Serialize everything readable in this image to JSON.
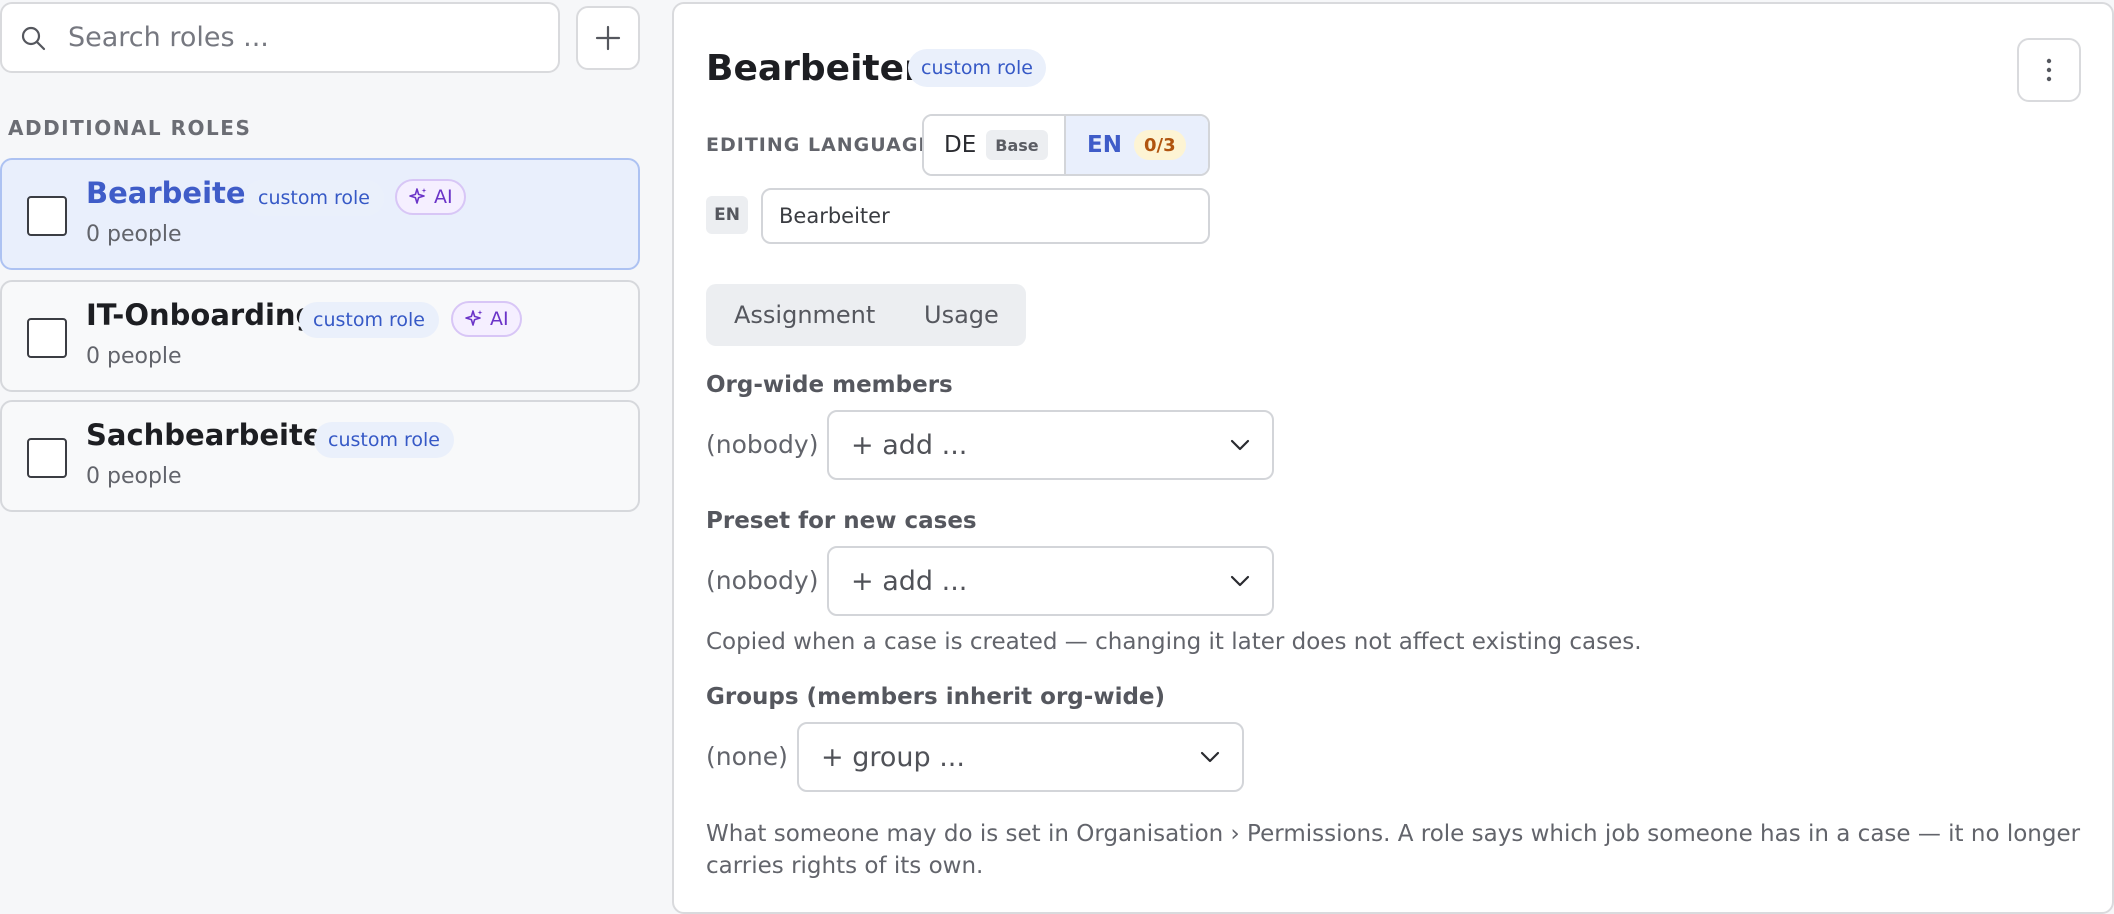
{
  "search": {
    "placeholder": "Search roles ..."
  },
  "sidebar": {
    "section_heading": "ADDITIONAL ROLES",
    "roles": [
      {
        "name": "Bearbeiter",
        "badge": "custom role",
        "ai": "AI",
        "people": "0 people",
        "selected": true
      },
      {
        "name": "IT-Onboarding",
        "badge": "custom role",
        "ai": "AI",
        "people": "0 people",
        "selected": false
      },
      {
        "name": "Sachbearbeiter",
        "badge": "custom role",
        "people": "0 people",
        "selected": false
      }
    ]
  },
  "detail": {
    "title": "Bearbeiter",
    "title_badge": "custom role",
    "editing_language_label": "EDITING LANGUAGE",
    "languages": {
      "de": {
        "code": "DE",
        "tag": "Base"
      },
      "en": {
        "code": "EN",
        "progress": "0/3"
      }
    },
    "name_field": {
      "lang_tag": "EN",
      "value": "Bearbeiter"
    },
    "tabs": [
      "Assignment",
      "Usage"
    ],
    "org_wide": {
      "label": "Org-wide members",
      "value": "(nobody)",
      "select": "+ add ..."
    },
    "preset": {
      "label": "Preset for new cases",
      "value": "(nobody)",
      "select": "+ add ...",
      "help": "Copied when a case is created — changing it later does not affect existing cases."
    },
    "groups": {
      "label": "Groups (members inherit org-wide)",
      "value": "(none)",
      "select": "+ group ..."
    },
    "footer_help_line1": "What someone may do is set in Organisation › Permissions. A role says which job someone has in a case — it no longer",
    "footer_help_line2": "carries rights of its own."
  },
  "colors": {
    "accent": "#3f5cc8",
    "selected_bg": "#e9effc",
    "ai_purple": "#6b34c8",
    "warn": "#b0540f"
  }
}
